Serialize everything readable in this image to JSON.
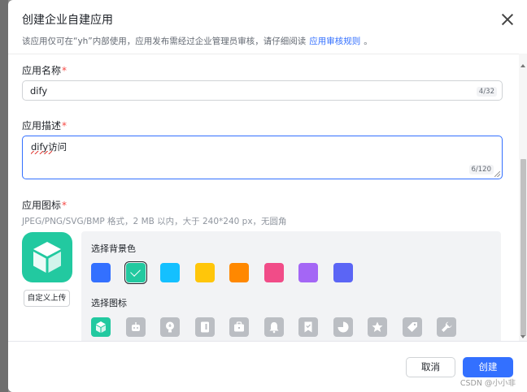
{
  "dialog": {
    "title": "创建企业自建应用",
    "subtitle": "该应用仅可在“yh”内部使用，应用发布需经过企业管理员审核，请仔细阅读",
    "subtitle_link": "应用审核规则",
    "subtitle_end": "。"
  },
  "form": {
    "name_label": "应用名称",
    "name_value": "dify",
    "name_counter": "4/32",
    "desc_label": "应用描述",
    "desc_value": "dify访问",
    "desc_counter": "6/120",
    "icon_label": "应用图标",
    "required_mark": "*",
    "icon_hint": "JPEG/PNG/SVG/BMP 格式，2 MB 以内，大于 240*240 px，无圆角",
    "upload_label": "自定义上传"
  },
  "picker": {
    "bg_title": "选择背景色",
    "icon_title": "选择图标",
    "colors": [
      "#3370ff",
      "#22c9a0",
      "#14c0ff",
      "#ffc60a",
      "#ff8800",
      "#f14c88",
      "#a466f5",
      "#5b65f5"
    ],
    "selected_color_index": 1,
    "icons": [
      "cube-icon",
      "robot-icon",
      "lightbulb-icon",
      "document-icon",
      "briefcase-icon",
      "bell-icon",
      "bookmark-check-icon",
      "pie-chart-icon",
      "star-icon",
      "tag-icon",
      "wrench-icon"
    ],
    "active_icon_index": 0
  },
  "footer": {
    "cancel_label": "取消",
    "create_label": "创建"
  },
  "watermark": "CSDN @小小非"
}
